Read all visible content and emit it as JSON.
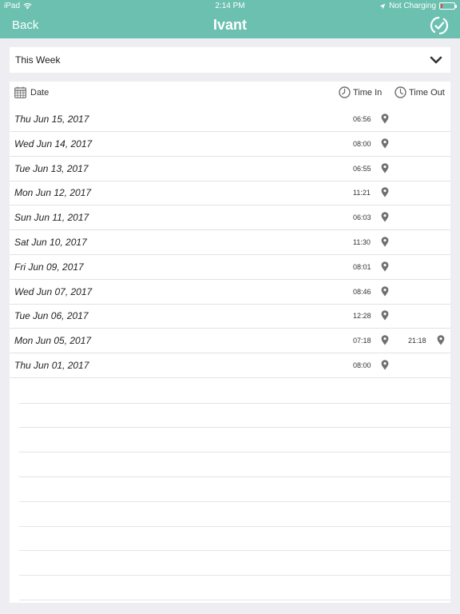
{
  "status_bar": {
    "device": "iPad",
    "time": "2:14 PM",
    "charging": "Not Charging"
  },
  "nav": {
    "back_label": "Back",
    "title": "Ivant",
    "sync_icon": "sync-icon"
  },
  "filter": {
    "selected": "This Week",
    "icon": "chevron-down-icon"
  },
  "table": {
    "headers": {
      "date": "Date",
      "time_in": "Time In",
      "time_out": "Time Out"
    },
    "rows": [
      {
        "date": "Thu Jun 15, 2017",
        "time_in": "06:56",
        "time_out": ""
      },
      {
        "date": "Wed Jun 14, 2017",
        "time_in": "08:00",
        "time_out": ""
      },
      {
        "date": "Tue Jun 13, 2017",
        "time_in": "06:55",
        "time_out": ""
      },
      {
        "date": "Mon Jun 12, 2017",
        "time_in": "11:21",
        "time_out": ""
      },
      {
        "date": "Sun Jun 11, 2017",
        "time_in": "06:03",
        "time_out": ""
      },
      {
        "date": "Sat Jun 10, 2017",
        "time_in": "11:30",
        "time_out": ""
      },
      {
        "date": "Fri Jun 09, 2017",
        "time_in": "08:01",
        "time_out": ""
      },
      {
        "date": "Wed Jun 07, 2017",
        "time_in": "08:46",
        "time_out": ""
      },
      {
        "date": "Tue Jun 06, 2017",
        "time_in": "12:28",
        "time_out": ""
      },
      {
        "date": "Mon Jun 05, 2017",
        "time_in": "07:18",
        "time_out": "21:18"
      },
      {
        "date": "Thu Jun 01, 2017",
        "time_in": "08:00",
        "time_out": ""
      }
    ]
  },
  "colors": {
    "accent": "#6bc0b0",
    "background": "#eeeef2",
    "icon_gray": "#6f6f6f",
    "battery_low": "#e54444"
  }
}
